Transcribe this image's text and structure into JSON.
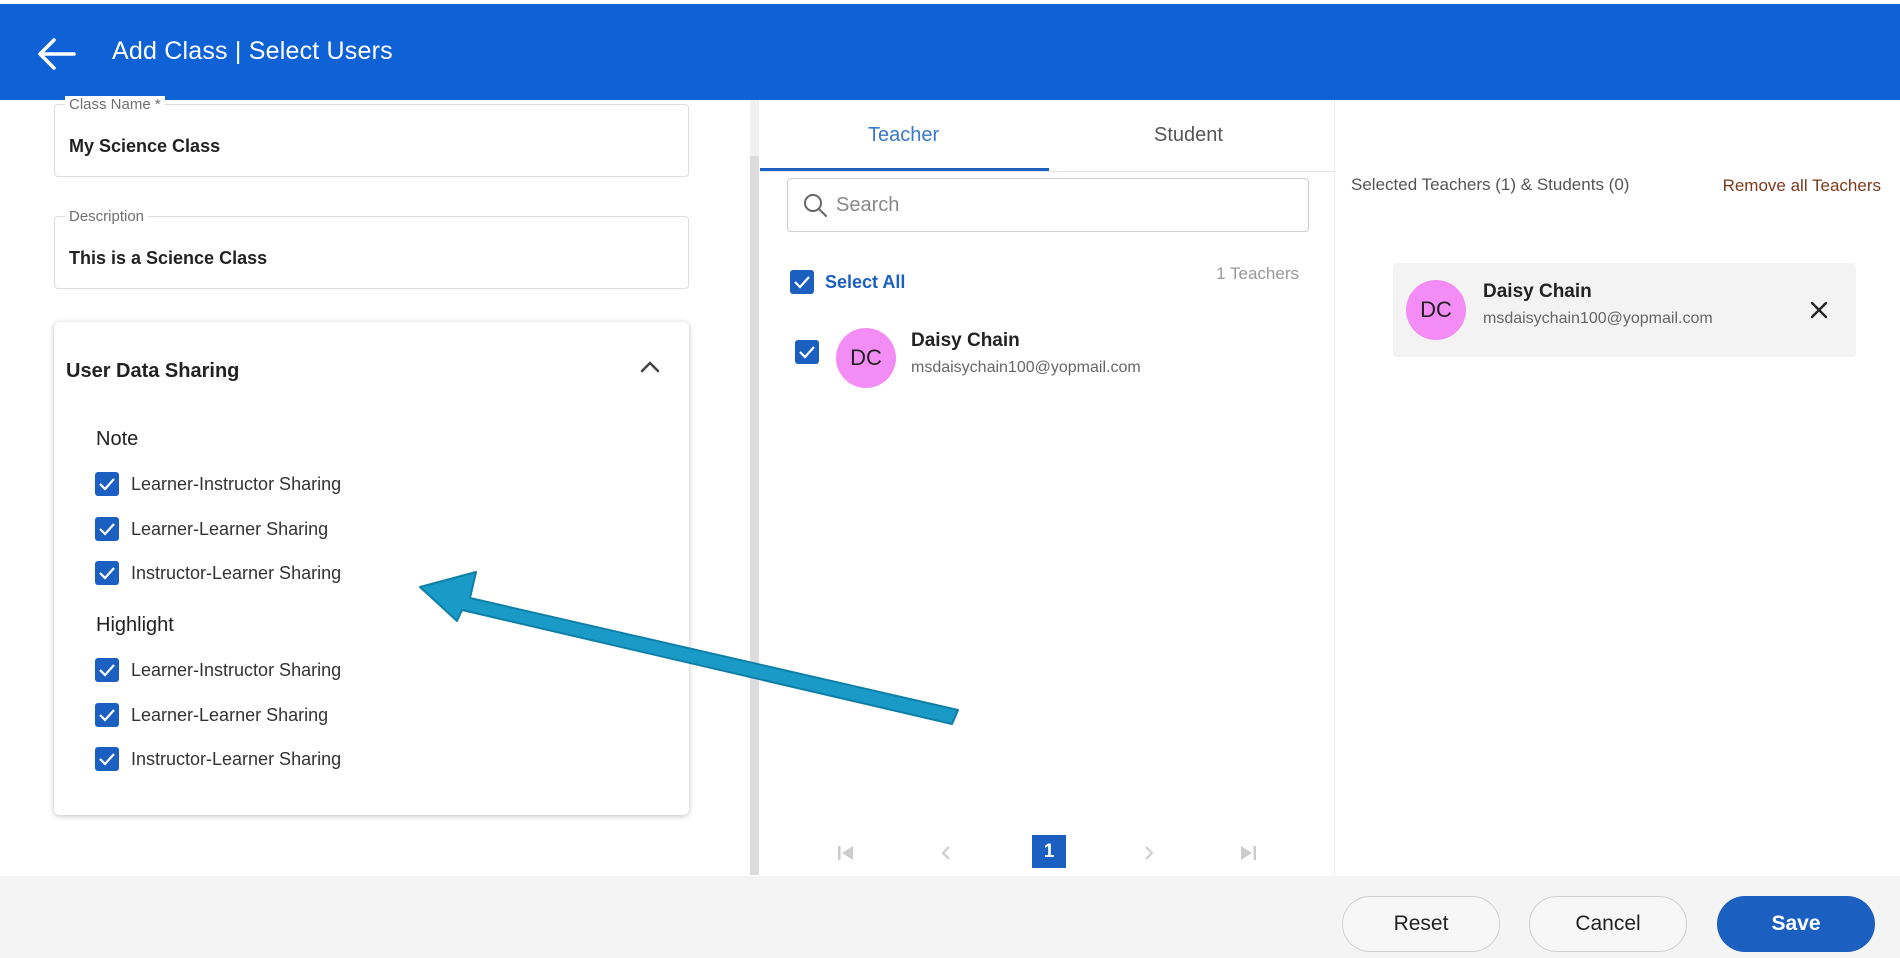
{
  "header": {
    "title": "Add Class | Select Users",
    "background_color": "#0f62d6"
  },
  "form": {
    "class_name": {
      "label": "Class Name *",
      "value": "My Science Class"
    },
    "description": {
      "label": "Description",
      "value": "This is a Science Class"
    }
  },
  "data_sharing": {
    "title": "User Data Sharing",
    "note": {
      "label": "Note",
      "options": [
        {
          "label": "Learner-Instructor Sharing",
          "checked": true
        },
        {
          "label": "Learner-Learner Sharing",
          "checked": true
        },
        {
          "label": "Instructor-Learner Sharing",
          "checked": true
        }
      ]
    },
    "highlight": {
      "label": "Highlight",
      "options": [
        {
          "label": "Learner-Instructor Sharing",
          "checked": true
        },
        {
          "label": "Learner-Learner Sharing",
          "checked": true
        },
        {
          "label": "Instructor-Learner Sharing",
          "checked": true
        }
      ]
    }
  },
  "tabs": [
    {
      "label": "Teacher",
      "active": true
    },
    {
      "label": "Student",
      "active": false
    }
  ],
  "search": {
    "placeholder": "Search",
    "value": ""
  },
  "list": {
    "select_all_label": "Select All",
    "count_label": "1 Teachers",
    "users": [
      {
        "initials": "DC",
        "name": "Daisy Chain",
        "email": "msdaisychain100@yopmail.com",
        "checked": true
      }
    ]
  },
  "pagination": {
    "current_page": "1"
  },
  "selected": {
    "summary": "Selected Teachers (1) & Students (0)",
    "remove_all_label": "Remove all Teachers",
    "users": [
      {
        "initials": "DC",
        "name": "Daisy Chain",
        "email": "msdaisychain100@yopmail.com"
      }
    ]
  },
  "footer": {
    "reset_label": "Reset",
    "cancel_label": "Cancel",
    "save_label": "Save"
  },
  "colors": {
    "accent": "#1b5fc0",
    "avatar": "#f38df5",
    "annotation_arrow": "#1a9bc7"
  }
}
